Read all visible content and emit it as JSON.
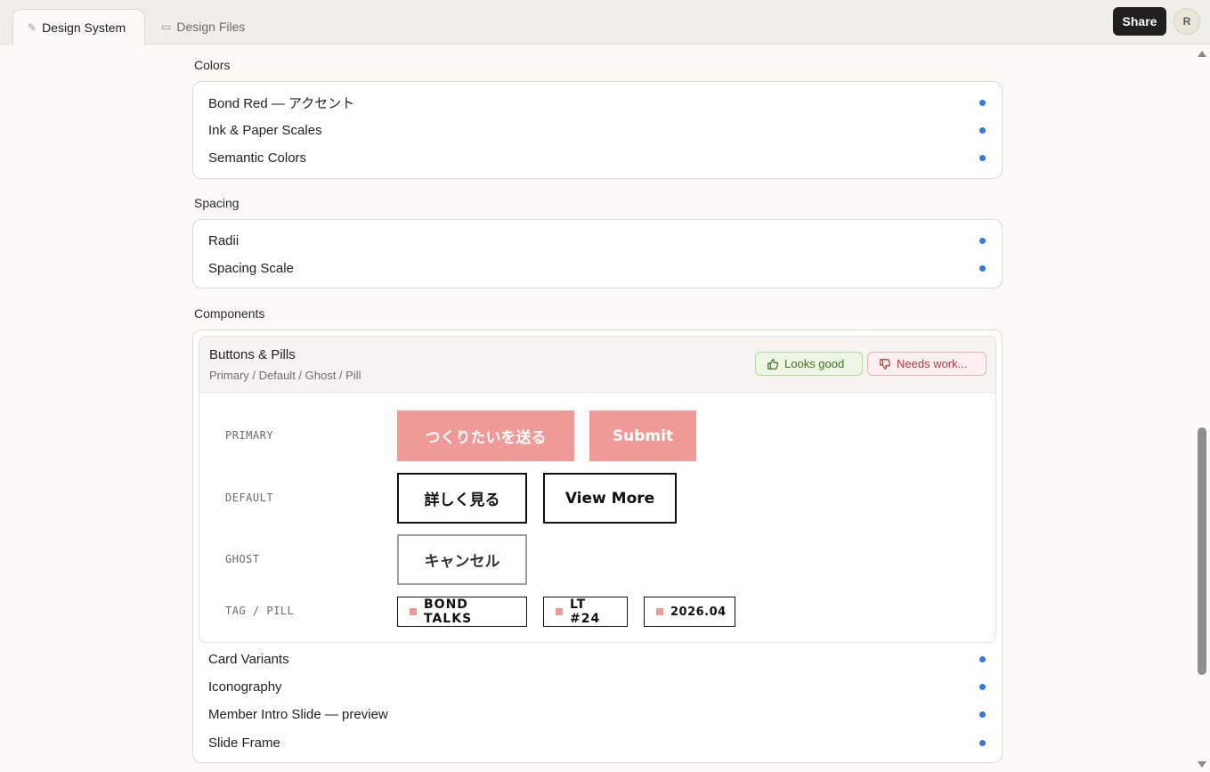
{
  "tabs": [
    {
      "label": "Design System",
      "icon": "pen-icon",
      "active": true
    },
    {
      "label": "Design Files",
      "icon": "folder-icon",
      "active": false
    }
  ],
  "header": {
    "share_label": "Share",
    "avatar_initial": "R"
  },
  "sections": {
    "colors": {
      "title": "Colors",
      "items": [
        "Bond Red — アクセント",
        "Ink & Paper Scales",
        "Semantic Colors"
      ]
    },
    "spacing": {
      "title": "Spacing",
      "items": [
        "Radii",
        "Spacing Scale"
      ]
    },
    "components": {
      "title": "Components",
      "expanded": {
        "title": "Buttons & Pills",
        "subtitle": "Primary / Default / Ghost / Pill",
        "feedback_good": "Looks good",
        "feedback_bad": "Needs work...",
        "variants": {
          "primary": {
            "label": "PRIMARY",
            "buttons": [
              "つくりたいを送る",
              "Submit"
            ]
          },
          "default": {
            "label": "DEFAULT",
            "buttons": [
              "詳しく見る",
              "View More"
            ]
          },
          "ghost": {
            "label": "GHOST",
            "buttons": [
              "キャンセル"
            ]
          },
          "pill": {
            "label": "TAG / PILL",
            "pills": [
              "BOND TALKS",
              "LT #24",
              "2026.04"
            ]
          }
        }
      },
      "items": [
        "Card Variants",
        "Iconography",
        "Member Intro Slide — preview",
        "Slide Frame"
      ]
    }
  },
  "colors": {
    "accent": "#f09a98",
    "status_dot": "#2f7ae5",
    "ink": "#111111",
    "good": "#3f6f22",
    "bad": "#b23a3a"
  }
}
